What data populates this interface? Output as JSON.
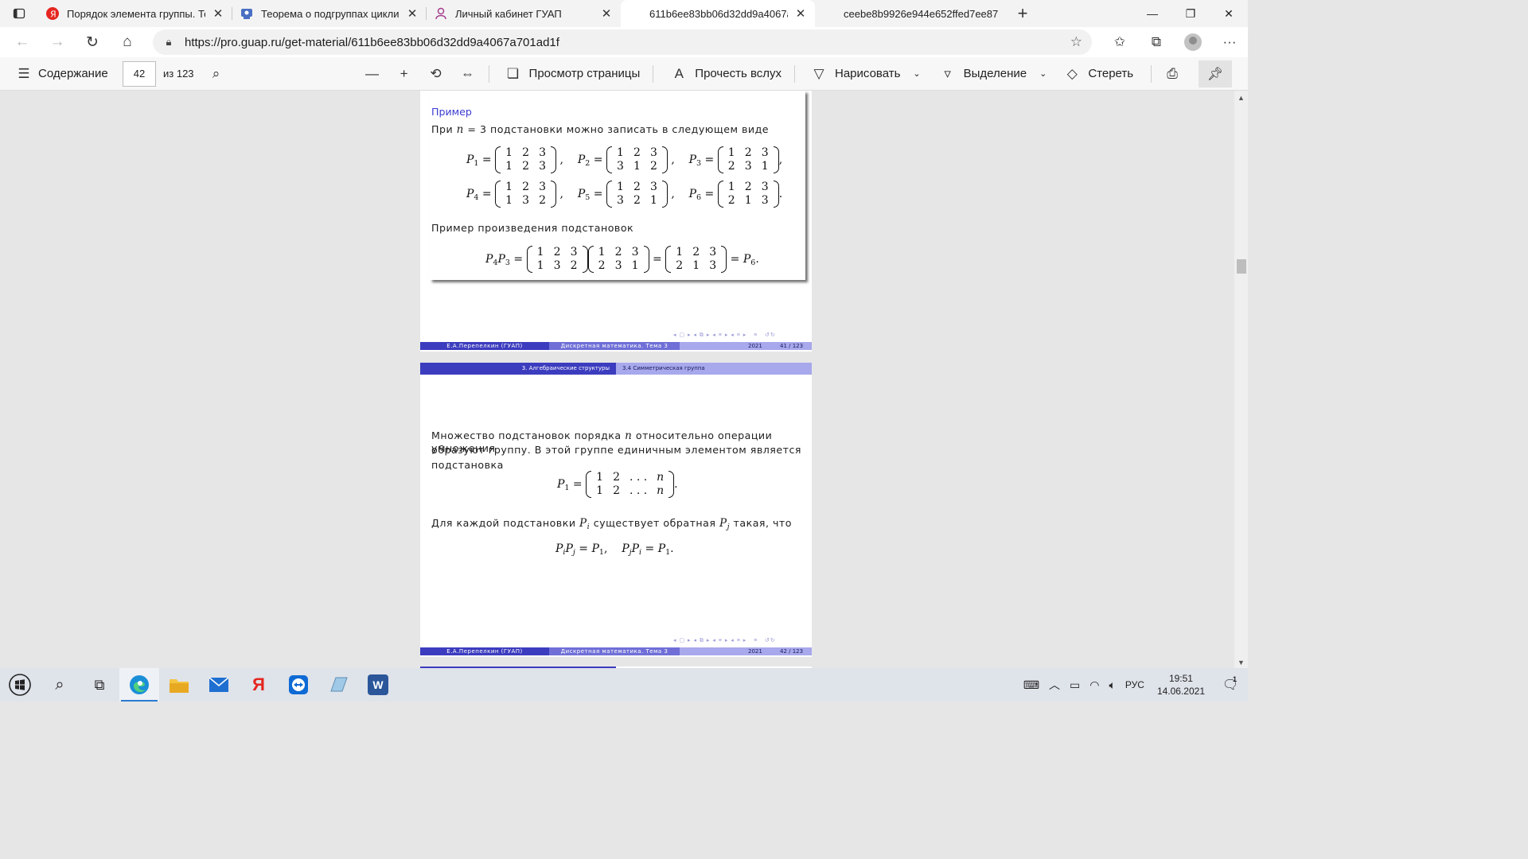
{
  "tabs": [
    {
      "title": "Порядок элемента группы. Теор",
      "icon": "yandex-icon",
      "color": "#e52620"
    },
    {
      "title": "Теорема о подгруппах цикличе",
      "icon": "chat-icon",
      "color": "#4a6fc3"
    },
    {
      "title": "Личный кабинет ГУАП",
      "icon": "person-icon",
      "color": "#a43d8c"
    },
    {
      "title": "611b6ee83bb06d32dd9a4067a7",
      "icon": "",
      "color": ""
    },
    {
      "title": "ceebe8b9926e944e652ffed7ee87",
      "icon": "",
      "color": ""
    }
  ],
  "address": {
    "url": "https://pro.guap.ru/get-material/611b6ee83bb06d32dd9a4067a701ad1f"
  },
  "pdf_toolbar": {
    "contents": "Содержание",
    "page": "42",
    "page_total": "из 123",
    "page_view": "Просмотр страницы",
    "read_aloud": "Прочесть вслух",
    "draw": "Нарисовать",
    "highlight": "Выделение",
    "erase": "Стереть"
  },
  "slide1": {
    "block_title": "Пример",
    "intro_pre": "При",
    "intro_n": "n",
    "intro_post": "= 3 подстановки можно записать в следующем виде",
    "product_text": "Пример произведения подстановок",
    "footer_author": "Е.А.Перепелкин  (ГУАП)",
    "footer_course": "Дискретная математика. Тема 3",
    "footer_year": "2021",
    "footer_page": "41 / 123"
  },
  "slide2": {
    "header_section": "3. Алгебраические структуры",
    "header_subsection": "3.4 Симметрическая группа",
    "para1_a": "Множество подстановок порядка",
    "para1_n": "n",
    "para1_b": "относительно операции умножения",
    "para1_line2": "образуют группу. В этой группе единичным элементом является",
    "para1_line3": "подстановка",
    "para2_a": "Для каждой подстановки",
    "para2_b": "существует обратная",
    "para2_c": "такая, что",
    "footer_author": "Е.А.Перепелкин  (ГУАП)",
    "footer_course": "Дискретная математика. Тема 3",
    "footer_year": "2021",
    "footer_page": "42 / 123"
  },
  "taskbar": {
    "lang": "РУС",
    "time": "19:51",
    "date": "14.06.2021",
    "notifications": "1"
  }
}
